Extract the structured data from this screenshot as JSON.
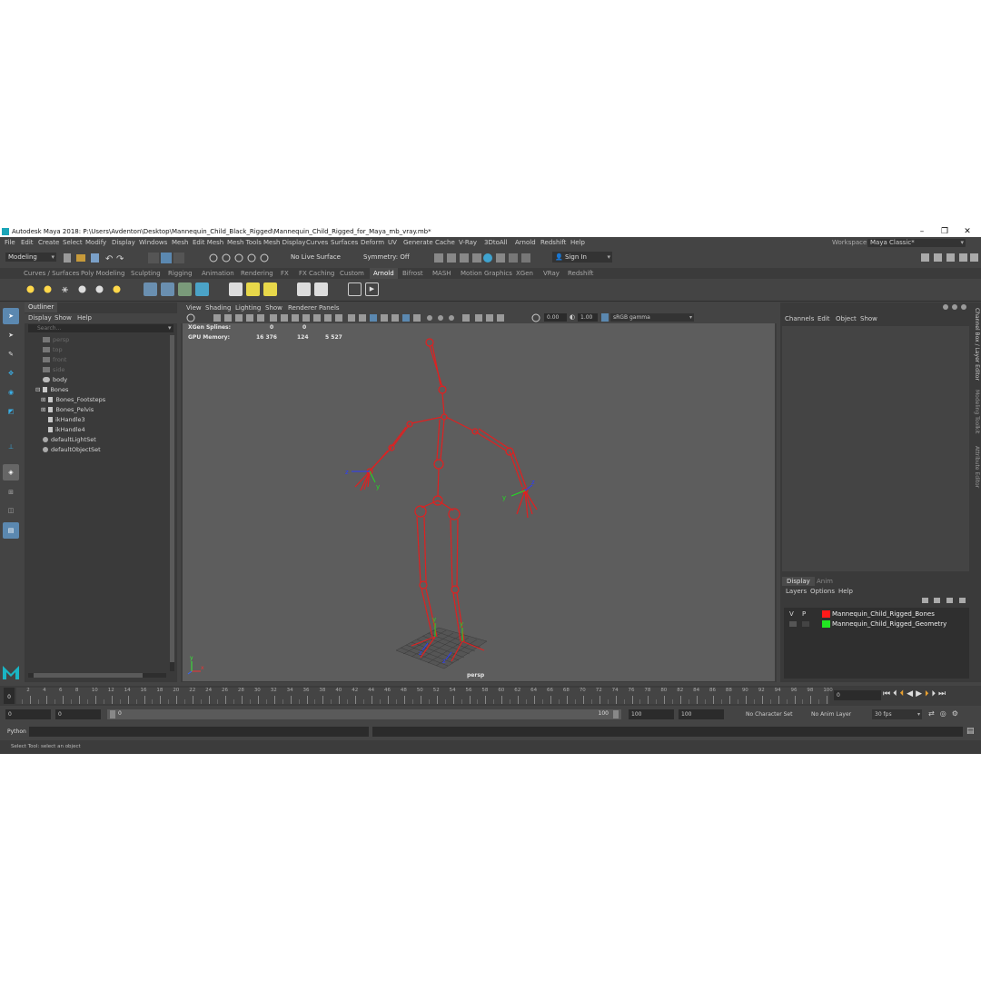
{
  "window": {
    "title": "Autodesk Maya 2018: P:\\Users\\Avdenton\\Desktop\\Mannequin_Child_Black_Rigged\\Mannequin_Child_Rigged_for_Maya_mb_vray.mb*",
    "min": "–",
    "max": "❐",
    "close": "✕"
  },
  "menubar": {
    "items": [
      "File",
      "Edit",
      "Create",
      "Select",
      "Modify",
      "Display",
      "Windows",
      "Mesh",
      "Edit Mesh",
      "Mesh Tools",
      "Mesh Display",
      "Curves",
      "Surfaces",
      "Deform",
      "UV",
      "Generate",
      "Cache",
      "V-Ray",
      "3DtoAll",
      "Arnold",
      "Redshift",
      "Help"
    ],
    "workspace_label": "Workspace :",
    "workspace_value": "Maya Classic*"
  },
  "statusline": {
    "mode": "Modeling",
    "live_surface": "No Live Surface",
    "symmetry": "Symmetry: Off",
    "sign_in": "Sign In"
  },
  "shelf_tabs": [
    "Curves / Surfaces",
    "Poly Modeling",
    "Sculpting",
    "Rigging",
    "Animation",
    "Rendering",
    "FX",
    "FX Caching",
    "Custom",
    "Arnold",
    "Bifrost",
    "MASH",
    "Motion Graphics",
    "XGen",
    "VRay",
    "Redshift"
  ],
  "shelf_active": "Arnold",
  "outliner": {
    "tab": "Outliner",
    "menu": [
      "Display",
      "Show",
      "Help"
    ],
    "search_placeholder": "Search...",
    "items": [
      {
        "label": "persp",
        "indent": 2,
        "dim": true
      },
      {
        "label": "top",
        "indent": 2,
        "dim": true
      },
      {
        "label": "front",
        "indent": 2,
        "dim": true
      },
      {
        "label": "side",
        "indent": 2,
        "dim": true
      },
      {
        "label": "body",
        "indent": 2,
        "dim": false
      },
      {
        "label": "Bones",
        "indent": 1,
        "dim": false
      },
      {
        "label": "Bones_Footsteps",
        "indent": 3,
        "dim": false
      },
      {
        "label": "Bones_Pelvis",
        "indent": 3,
        "dim": false
      },
      {
        "label": "ikHandle3",
        "indent": 3,
        "dim": false
      },
      {
        "label": "ikHandle4",
        "indent": 3,
        "dim": false
      },
      {
        "label": "defaultLightSet",
        "indent": 2,
        "dim": false
      },
      {
        "label": "defaultObjectSet",
        "indent": 2,
        "dim": false
      }
    ]
  },
  "viewport": {
    "menu": [
      "View",
      "Shading",
      "Lighting",
      "Show",
      "Renderer",
      "Panels"
    ],
    "exposure": "0.00",
    "gamma": "1.00",
    "color_space": "sRGB gamma",
    "hud": {
      "xgen_label": "XGen Splines:",
      "xgen_v1": "0",
      "xgen_v2": "0",
      "gpu_label": "GPU Memory:",
      "gpu_v1": "16 376",
      "gpu_v2": "124",
      "gpu_v3": "5 527"
    },
    "camera_label": "persp",
    "bone_color": "#e02020"
  },
  "channelbox": {
    "menu": [
      "Channels",
      "Edit",
      "Object",
      "Show"
    ],
    "layer_tabs": [
      "Display",
      "Anim"
    ],
    "layer_menu": [
      "Layers",
      "Options",
      "Help"
    ],
    "layers": [
      {
        "v": "V",
        "p": "P",
        "color": "#ff1a1a",
        "name": "Mannequin_Child_Rigged_Bones"
      },
      {
        "v": "",
        "p": "",
        "color": "#22e622",
        "name": "Mannequin_Child_Rigged_Geometry"
      }
    ]
  },
  "side_tabs": [
    "Channel Box / Layer Editor",
    "Modeling Toolkit",
    "Attribute Editor"
  ],
  "timeslider": {
    "ticks": [
      "2",
      "4",
      "6",
      "8",
      "10",
      "12",
      "14",
      "16",
      "18",
      "20",
      "22",
      "24",
      "26",
      "28",
      "30",
      "32",
      "34",
      "36",
      "38",
      "40",
      "42",
      "44",
      "46",
      "48",
      "50",
      "52",
      "54",
      "56",
      "58",
      "60",
      "62",
      "64",
      "66",
      "68",
      "70",
      "72",
      "74",
      "76",
      "78",
      "80",
      "82",
      "84",
      "86",
      "88",
      "90",
      "92",
      "94",
      "96",
      "98",
      "100"
    ],
    "current_frame": "0",
    "frame_marker": "0"
  },
  "range": {
    "start": "0",
    "start2": "0",
    "range_start": "0",
    "range_end": "100",
    "end": "100",
    "end2": "100",
    "character_set": "No Character Set",
    "anim_layer": "No Anim Layer",
    "fps": "30 fps"
  },
  "cmdline": {
    "lang": "Python"
  },
  "helpline": {
    "text": "Select Tool: select an object"
  }
}
